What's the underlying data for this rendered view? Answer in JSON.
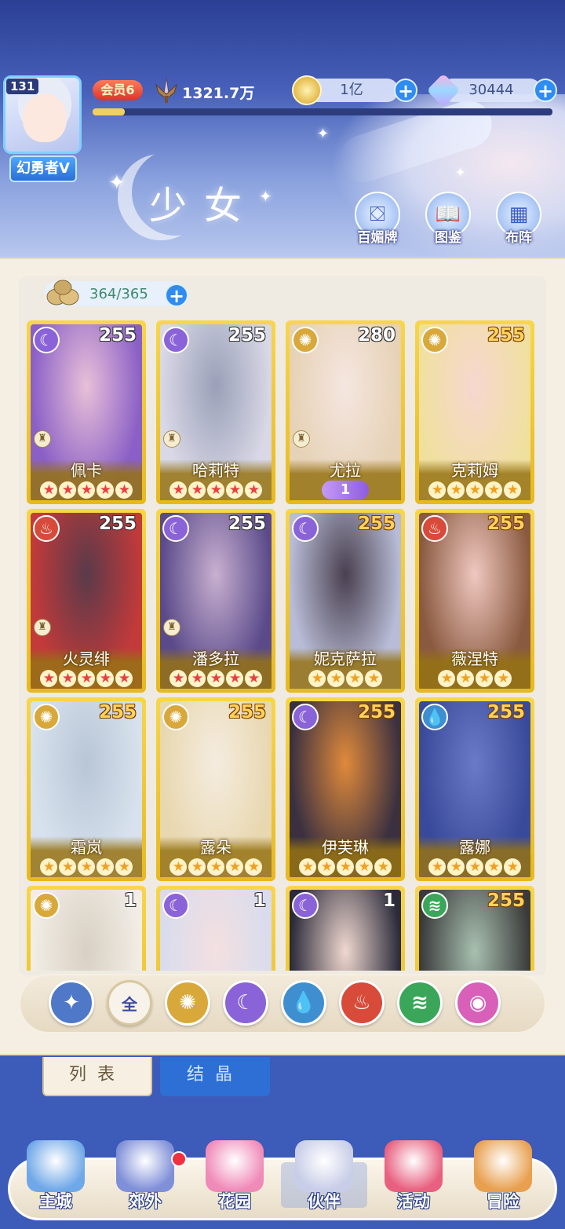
{
  "header": {
    "player_level": "131",
    "player_name": "幻勇者V",
    "vip_label": "会员6",
    "power": "1321.7万",
    "xp_progress": 0.07,
    "gold": "1亿",
    "gems": "30444",
    "section_title": "少女",
    "buttons": [
      {
        "label": "百媚牌",
        "icon": "card-gallery-icon"
      },
      {
        "label": "图鉴",
        "icon": "book-icon"
      },
      {
        "label": "布阵",
        "icon": "formation-grid-icon"
      }
    ]
  },
  "inventory": {
    "count": "364/365"
  },
  "elements": {
    "moon": {
      "color": "#8a63d8",
      "glyph": "☾"
    },
    "sun": {
      "color": "#d9a83a",
      "glyph": "✺"
    },
    "fire": {
      "color": "#d84a3a",
      "glyph": "♨"
    },
    "water": {
      "color": "#3f8fd0",
      "glyph": "💧"
    },
    "wind": {
      "color": "#3aa65a",
      "glyph": "≋"
    }
  },
  "cards": [
    {
      "name": "佩卡",
      "level": "255",
      "element": "moon",
      "stars": 5,
      "art": [
        "#8a5fc6",
        "#e8c0d8"
      ],
      "gold_level": false,
      "rook": true
    },
    {
      "name": "哈莉特",
      "level": "255",
      "element": "moon",
      "stars": 5,
      "art": [
        "#d8d8e6",
        "#9aa0b8"
      ],
      "gold_level": false,
      "rook": true
    },
    {
      "name": "尤拉",
      "level": "280",
      "element": "sun",
      "stars": 0,
      "badge": "1",
      "art": [
        "#e6d2b6",
        "#f5e6e0"
      ],
      "gold_level": false,
      "rook": true
    },
    {
      "name": "克莉姆",
      "level": "255",
      "element": "sun",
      "stars": 5,
      "art": [
        "#f0e0a0",
        "#f7d7d0"
      ],
      "gold_level": true,
      "rook": false
    },
    {
      "name": "火灵绯",
      "level": "255",
      "element": "fire",
      "stars": 5,
      "art": [
        "#c23a3a",
        "#5a3a4a"
      ],
      "gold_level": false,
      "rook": true
    },
    {
      "name": "潘多拉",
      "level": "255",
      "element": "moon",
      "stars": 5,
      "art": [
        "#5a4a8a",
        "#c8b0d0"
      ],
      "gold_level": false,
      "rook": true
    },
    {
      "name": "妮克萨拉",
      "level": "255",
      "element": "moon",
      "stars": 4,
      "art": [
        "#b8bcd6",
        "#4a4050"
      ],
      "gold_level": true,
      "rook": false
    },
    {
      "name": "薇涅特",
      "level": "255",
      "element": "fire",
      "stars": 4,
      "art": [
        "#8a5a40",
        "#f0c8c0"
      ],
      "gold_level": true,
      "rook": false
    },
    {
      "name": "霜岚",
      "level": "255",
      "element": "sun",
      "stars": 5,
      "art": [
        "#d8e2ee",
        "#b8c6d6"
      ],
      "gold_level": true,
      "rook": false
    },
    {
      "name": "露朵",
      "level": "255",
      "element": "sun",
      "stars": 5,
      "art": [
        "#e8d8b0",
        "#f5ece0"
      ],
      "gold_level": true,
      "rook": false
    },
    {
      "name": "伊芙琳",
      "level": "255",
      "element": "moon",
      "stars": 5,
      "art": [
        "#3a3040",
        "#e08a3a"
      ],
      "gold_level": true,
      "rook": false
    },
    {
      "name": "露娜",
      "level": "255",
      "element": "water",
      "stars": 5,
      "art": [
        "#3a4a9a",
        "#6a7ac8"
      ],
      "gold_level": true,
      "rook": false
    },
    {
      "name": "",
      "level": "1",
      "element": "sun",
      "stars": 0,
      "art": [
        "#f2eee6",
        "#d8d0c4"
      ],
      "gold_level": false,
      "rook": false
    },
    {
      "name": "",
      "level": "1",
      "element": "moon",
      "stars": 0,
      "art": [
        "#d8dcee",
        "#f4e0e0"
      ],
      "gold_level": false,
      "rook": false
    },
    {
      "name": "",
      "level": "1",
      "element": "moon",
      "stars": 0,
      "art": [
        "#2a2a3a",
        "#f0d8d0"
      ],
      "gold_level": false,
      "rook": false
    },
    {
      "name": "",
      "level": "255",
      "element": "wind",
      "stars": 0,
      "art": [
        "#3a3a3a",
        "#a8c0b0"
      ],
      "gold_level": true,
      "rook": false
    }
  ],
  "filters": [
    {
      "id": "special",
      "label": "✦",
      "color": "#4f78c8"
    },
    {
      "id": "all",
      "label": "全",
      "color": "#f7f2ea"
    },
    {
      "id": "sun",
      "label": "✺",
      "color": "#d9a83a"
    },
    {
      "id": "moon",
      "label": "☾",
      "color": "#8a63d8"
    },
    {
      "id": "water",
      "label": "💧",
      "color": "#3f8fd0"
    },
    {
      "id": "fire",
      "label": "♨",
      "color": "#d84a3a"
    },
    {
      "id": "wind",
      "label": "≋",
      "color": "#3aa65a"
    },
    {
      "id": "star",
      "label": "◉",
      "color": "#d860b8"
    }
  ],
  "tabs": {
    "list": "列表",
    "crystal": "结晶"
  },
  "nav": [
    {
      "label": "主城",
      "icon": "castle-icon",
      "color": "#6fa8e8"
    },
    {
      "label": "郊外",
      "icon": "portal-icon",
      "color": "#7f8fd8",
      "dot": true
    },
    {
      "label": "花园",
      "icon": "heart-icon",
      "color": "#f08ab8"
    },
    {
      "label": "伙伴",
      "icon": "partner-icon",
      "color": "#c8cde8",
      "active": true
    },
    {
      "label": "活动",
      "icon": "gift-icon",
      "color": "#e86080"
    },
    {
      "label": "冒险",
      "icon": "compass-icon",
      "color": "#e8a050"
    }
  ]
}
